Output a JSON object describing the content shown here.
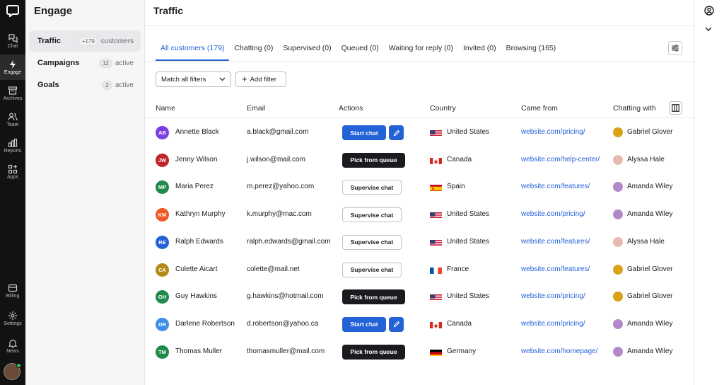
{
  "rail": {
    "items": [
      {
        "label": "Chat",
        "icon": "chat-icon"
      },
      {
        "label": "Engage",
        "icon": "bolt-icon"
      },
      {
        "label": "Archives",
        "icon": "archive-icon"
      },
      {
        "label": "Team",
        "icon": "team-icon"
      },
      {
        "label": "Reports",
        "icon": "reports-icon"
      },
      {
        "label": "Apps",
        "icon": "apps-icon"
      },
      {
        "label": "Billing",
        "icon": "billing-icon"
      },
      {
        "label": "Settings",
        "icon": "gear-icon"
      },
      {
        "label": "News",
        "icon": "bell-icon"
      }
    ]
  },
  "sidebar": {
    "title": "Engage",
    "items": [
      {
        "name": "Traffic",
        "count": "+179",
        "suffix": "customers"
      },
      {
        "name": "Campaigns",
        "count": "12",
        "suffix": "active"
      },
      {
        "name": "Goals",
        "count": "2",
        "suffix": "active"
      }
    ]
  },
  "main": {
    "title": "Traffic",
    "tabs": [
      "All customers (179)",
      "Chatting (0)",
      "Supervised (0)",
      "Queued (0)",
      "Waiting for reply (0)",
      "Invited (0)",
      "Browsing (165)"
    ],
    "filter_select": "Match all filters",
    "add_filter": "Add filter",
    "columns": [
      "Name",
      "Email",
      "Actions",
      "Country",
      "Came from",
      "Chatting with"
    ]
  },
  "rows": [
    {
      "initials": "AB",
      "color": "#7b3fe4",
      "name": "Annette Black",
      "email": "a.black@gmail.com",
      "action": "Start chat",
      "action_type": "start",
      "country": "United States",
      "flag": "us",
      "came_from": "website.com/pricing/",
      "agent": "Gabriel Glover",
      "agent_color": "#d8a219"
    },
    {
      "initials": "JW",
      "color": "#c0262c",
      "name": "Jenny Wilson",
      "email": "j.wilson@mail.com",
      "action": "Pick from queue",
      "action_type": "queue",
      "country": "Canada",
      "flag": "ca",
      "came_from": "website.com/help-center/",
      "agent": "Alyssa Hale",
      "agent_color": "#e7b9b0"
    },
    {
      "initials": "MP",
      "color": "#1f8a4c",
      "name": "Maria Perez",
      "email": "m.perez@yahoo.com",
      "action": "Supervise chat",
      "action_type": "supervise",
      "country": "Spain",
      "flag": "es",
      "came_from": "website.com/features/",
      "agent": "Amanda Wiley",
      "agent_color": "#b38ac9"
    },
    {
      "initials": "KM",
      "color": "#ee5a24",
      "name": "Kathryn Murphy",
      "email": "k.murphy@mac.com",
      "action": "Supervise chat",
      "action_type": "supervise",
      "country": "United States",
      "flag": "us",
      "came_from": "website.com/pricing/",
      "agent": "Amanda Wiley",
      "agent_color": "#b38ac9"
    },
    {
      "initials": "RE",
      "color": "#2462d8",
      "name": "Ralph Edwards",
      "email": "ralph.edwards@gmail.com",
      "action": "Supervise chat",
      "action_type": "supervise",
      "country": "United States",
      "flag": "us",
      "came_from": "website.com/features/",
      "agent": "Alyssa Hale",
      "agent_color": "#e7b9b0"
    },
    {
      "initials": "CA",
      "color": "#b58a16",
      "name": "Colette Aicart",
      "email": "colette@mail.net",
      "action": "Supervise chat",
      "action_type": "supervise",
      "country": "France",
      "flag": "fr",
      "came_from": "website.com/features/",
      "agent": "Gabriel Glover",
      "agent_color": "#d8a219"
    },
    {
      "initials": "GH",
      "color": "#1f8a4c",
      "name": "Guy Hawkins",
      "email": "g.hawkins@hotmail.com",
      "action": "Pick from queue",
      "action_type": "queue",
      "country": "United States",
      "flag": "us",
      "came_from": "website.com/pricing/",
      "agent": "Gabriel Glover",
      "agent_color": "#d8a219"
    },
    {
      "initials": "DR",
      "color": "#3d8fe8",
      "name": "Darlene Robertson",
      "email": "d.robertson@yahoo.ca",
      "action": "Start chat",
      "action_type": "start",
      "country": "Canada",
      "flag": "ca",
      "came_from": "website.com/pricing/",
      "agent": "Amanda Wiley",
      "agent_color": "#b38ac9"
    },
    {
      "initials": "TM",
      "color": "#1f8a4c",
      "name": "Thomas Muller",
      "email": "thomasmuller@mail.com",
      "action": "Pick from queue",
      "action_type": "queue",
      "country": "Germany",
      "flag": "de",
      "came_from": "website.com/homepage/",
      "agent": "Amanda Wiley",
      "agent_color": "#b38ac9"
    }
  ]
}
